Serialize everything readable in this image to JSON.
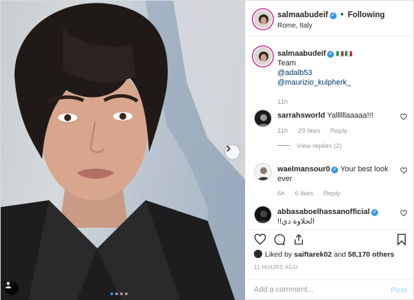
{
  "post": {
    "author": "salmaabudeif",
    "follow_separator": "•",
    "follow_label": "Following",
    "location": "Rome, Italy"
  },
  "caption": {
    "username": "salmaabudeif",
    "flags": "🇮🇹🇮🇹",
    "line1": "Team",
    "mention1": "@adalb53",
    "mention2": "@maurizio_kulpherk_",
    "time": "11h"
  },
  "comments": [
    {
      "username": "sarrahsworld",
      "text": "Yallllllaaaaa!!!",
      "time": "11h",
      "likes": "29 likes",
      "reply": "Reply",
      "verified": false
    },
    {
      "username": "waelmansour0",
      "text": "Your best look ever",
      "time": "6h",
      "likes": "6 likes",
      "reply": "Reply",
      "verified": true
    },
    {
      "username": "abbasaboelhassanofficial",
      "text": "الحلاوة دي!!",
      "verified": true
    }
  ],
  "view_replies": "View replies (2)",
  "likes_summary": {
    "prefix": "Liked by ",
    "user": "saiftarek02",
    "middle": " and ",
    "count": "58,170 others"
  },
  "timestamp": "11 HOURS AGO",
  "comment_box": {
    "placeholder": "Add a comment...",
    "post_label": "Post"
  },
  "icons": {
    "heart": "heart-icon",
    "comment": "comment-icon",
    "share": "share-icon",
    "save": "bookmark-icon",
    "verified": "verified-badge-icon",
    "next": "chevron-right-icon",
    "tag": "user-tag-icon"
  },
  "carousel": {
    "slide_count": 4,
    "active_index": 0
  },
  "colors": {
    "accent": "#3897f0",
    "post_disabled": "#b2dffc",
    "muted": "#999999",
    "text": "#262626"
  }
}
